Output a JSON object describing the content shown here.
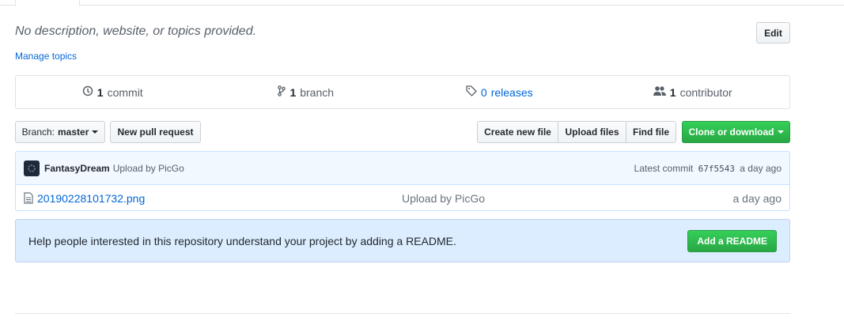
{
  "description": "No description, website, or topics provided.",
  "manage_topics": "Manage topics",
  "edit_label": "Edit",
  "summary": {
    "commits": {
      "count": "1",
      "label": "commit"
    },
    "branches": {
      "count": "1",
      "label": "branch"
    },
    "releases": {
      "count": "0",
      "label": "releases"
    },
    "contributors": {
      "count": "1",
      "label": "contributor"
    }
  },
  "toolbar": {
    "branch_prefix": "Branch:",
    "branch_value": "master",
    "new_pr": "New pull request",
    "create_file": "Create new file",
    "upload_files": "Upload files",
    "find_file": "Find file",
    "clone": "Clone or download"
  },
  "commit": {
    "author": "FantasyDream",
    "message": "Upload by PicGo",
    "latest_prefix": "Latest commit",
    "sha": "67f5543",
    "age": "a day ago"
  },
  "files": [
    {
      "name": "20190228101732.png",
      "message": "Upload by PicGo",
      "age": "a day ago"
    }
  ],
  "readme": {
    "message": "Help people interested in this repository understand your project by adding a README.",
    "button": "Add a README"
  },
  "colors": {
    "link": "#0366d6",
    "green": "#28a745",
    "readme_bg": "#dbedff"
  }
}
